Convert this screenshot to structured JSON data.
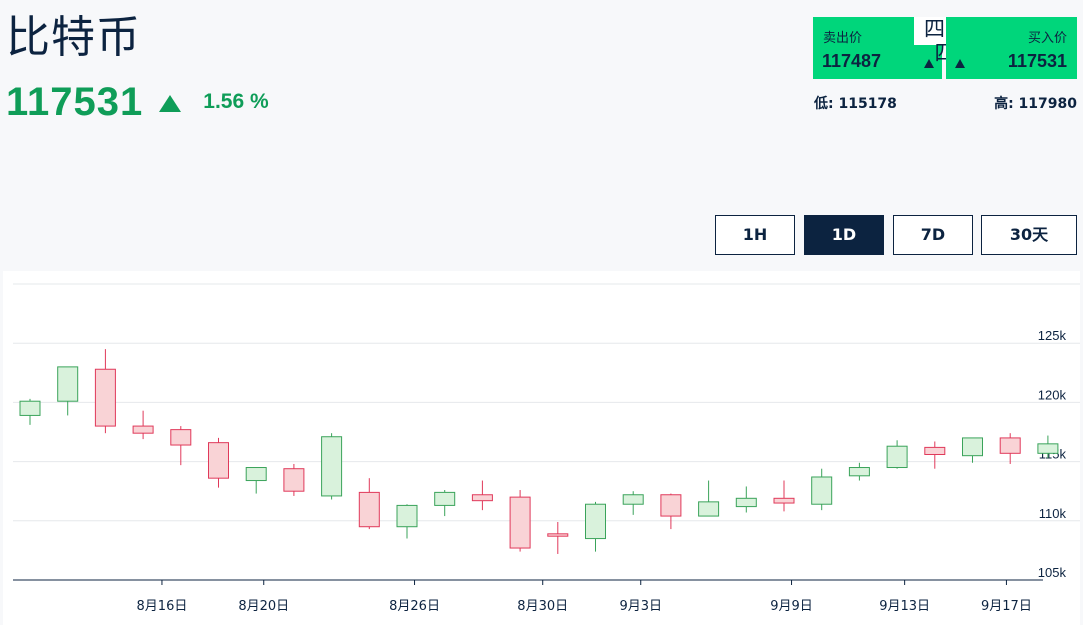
{
  "header": {
    "title": "比特币",
    "price": "117531",
    "change": "1.56 %"
  },
  "quote": {
    "sell_label": "卖出价",
    "sell_value": "117487",
    "spread": "四十四",
    "buy_label": "买入价",
    "buy_value": "117531",
    "low": "低: 115178",
    "high": "高: 117980"
  },
  "timeframes": [
    {
      "label": "1H",
      "active": false
    },
    {
      "label": "1D",
      "active": true
    },
    {
      "label": "7D",
      "active": false
    },
    {
      "label": "30天",
      "active": false
    }
  ],
  "colors": {
    "up_fill": "#d9f2dc",
    "up_stroke": "#3aa35a",
    "down_fill": "#f9d3d6",
    "down_stroke": "#e0395a",
    "accent_green": "#00d67b",
    "price_green": "#0f9d58",
    "navy": "#0c2340"
  },
  "chart_data": {
    "type": "candlestick",
    "y_ticks": [
      "125k",
      "120k",
      "115k",
      "110k",
      "105k"
    ],
    "y_tick_values": [
      125000,
      120000,
      115000,
      110000,
      105000
    ],
    "ylim": [
      105000,
      130000
    ],
    "x_ticks": [
      {
        "label": "8月16日",
        "index": 3.5
      },
      {
        "label": "8月20日",
        "index": 6.2
      },
      {
        "label": "8月26日",
        "index": 10.2
      },
      {
        "label": "8月30日",
        "index": 13.6
      },
      {
        "label": "9月3日",
        "index": 16.2
      },
      {
        "label": "9月9日",
        "index": 20.2
      },
      {
        "label": "9月13日",
        "index": 23.2
      },
      {
        "label": "9月17日",
        "index": 25.9
      }
    ],
    "grid": true,
    "candles": [
      {
        "open": 118900,
        "high": 120300,
        "low": 118100,
        "close": 120100
      },
      {
        "open": 120100,
        "high": 123000,
        "low": 118900,
        "close": 123000
      },
      {
        "open": 122800,
        "high": 124500,
        "low": 117400,
        "close": 118000
      },
      {
        "open": 118000,
        "high": 119300,
        "low": 116900,
        "close": 117400
      },
      {
        "open": 117700,
        "high": 118000,
        "low": 114700,
        "close": 116400
      },
      {
        "open": 116600,
        "high": 117000,
        "low": 112800,
        "close": 113600
      },
      {
        "open": 113400,
        "high": 114500,
        "low": 112300,
        "close": 114500
      },
      {
        "open": 114400,
        "high": 114800,
        "low": 112100,
        "close": 112500
      },
      {
        "open": 112100,
        "high": 117400,
        "low": 111800,
        "close": 117100
      },
      {
        "open": 112400,
        "high": 113600,
        "low": 109300,
        "close": 109500
      },
      {
        "open": 109500,
        "high": 111400,
        "low": 108500,
        "close": 111300
      },
      {
        "open": 111300,
        "high": 112600,
        "low": 110400,
        "close": 112400
      },
      {
        "open": 112200,
        "high": 113400,
        "low": 110900,
        "close": 111700
      },
      {
        "open": 112000,
        "high": 112600,
        "low": 107400,
        "close": 107700
      },
      {
        "open": 108900,
        "high": 109900,
        "low": 107200,
        "close": 108700
      },
      {
        "open": 108500,
        "high": 111600,
        "low": 107400,
        "close": 111400
      },
      {
        "open": 111400,
        "high": 112500,
        "low": 110500,
        "close": 112200
      },
      {
        "open": 112200,
        "high": 112300,
        "low": 109300,
        "close": 110400
      },
      {
        "open": 110400,
        "high": 113400,
        "low": 110400,
        "close": 111600
      },
      {
        "open": 111200,
        "high": 112900,
        "low": 110700,
        "close": 111900
      },
      {
        "open": 111900,
        "high": 113400,
        "low": 110800,
        "close": 111500
      },
      {
        "open": 111400,
        "high": 114400,
        "low": 110900,
        "close": 113700
      },
      {
        "open": 113800,
        "high": 114900,
        "low": 113400,
        "close": 114500
      },
      {
        "open": 114500,
        "high": 116800,
        "low": 114400,
        "close": 116300
      },
      {
        "open": 116200,
        "high": 116700,
        "low": 114400,
        "close": 115600
      },
      {
        "open": 115500,
        "high": 117000,
        "low": 114900,
        "close": 117000
      },
      {
        "open": 117000,
        "high": 117400,
        "low": 114800,
        "close": 115700
      },
      {
        "open": 115700,
        "high": 117200,
        "low": 115300,
        "close": 116500
      }
    ]
  }
}
